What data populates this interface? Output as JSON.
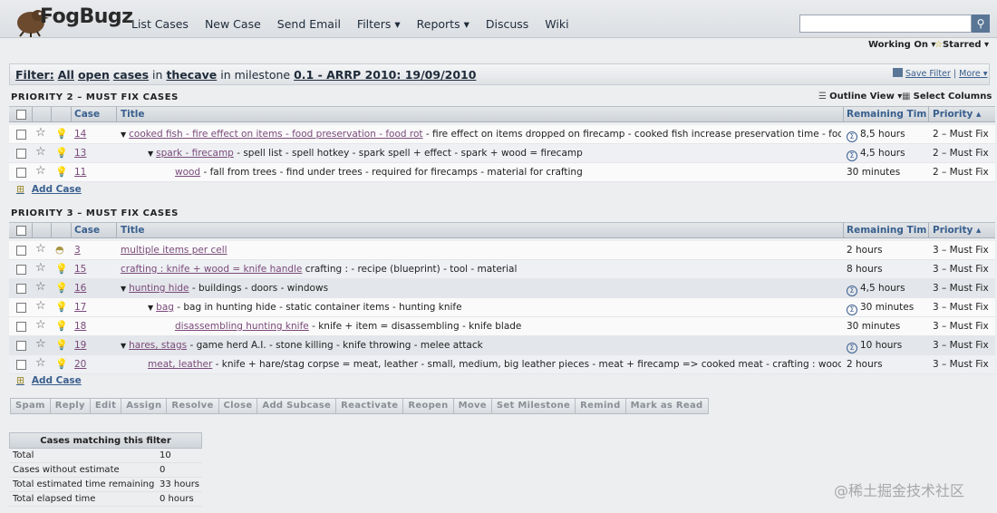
{
  "header": {
    "logo_text": "FogBugz",
    "nav": [
      "List Cases",
      "New Case",
      "Send Email",
      "Filters ▾",
      "Reports ▾",
      "Discuss",
      "Wiki"
    ],
    "search_placeholder": "",
    "working_on": "Working On ▾",
    "starred": "Starred ▾"
  },
  "filter": {
    "label": "Filter:",
    "all": "All",
    "open": "open",
    "cases": "cases",
    "in": "in",
    "project": "thecave",
    "in_milestone": "in milestone",
    "milestone": "0.1 - ARRP 2010: 19/09/2010",
    "save_filter": "Save Filter",
    "more": "More ▾"
  },
  "view": {
    "outline": "Outline View ▾",
    "select_columns": "Select Columns"
  },
  "columns": {
    "case": "Case",
    "title": "Title",
    "remaining": "Remaining Time",
    "priority": "Priority ▴"
  },
  "groups": [
    {
      "title": "PRIORITY 2 – MUST FIX CASES",
      "add_case": "Add Case",
      "rows": [
        {
          "case": "14",
          "indent": 0,
          "tri": true,
          "link": "cooked fish - fire effect on items - food preservation - food rot",
          "rest": " - fire effect on items dropped on firecamp  - cooked fish increase preservation time  - food rot",
          "rem": "8,5 hours",
          "sigma": true,
          "pri": "2 – Must Fix"
        },
        {
          "case": "13",
          "indent": 1,
          "tri": true,
          "link": "spark - firecamp",
          "rest": " - spell list - spell hotkey - spark spell + effect - spark + wood = firecamp",
          "rem": "4,5 hours",
          "sigma": true,
          "pri": "2 – Must Fix"
        },
        {
          "case": "11",
          "indent": 2,
          "tri": false,
          "link": "wood",
          "rest": " - fall from trees  - find under trees  - required for firecamps  - material for crafting",
          "rem": "30 minutes",
          "sigma": false,
          "pri": "2 – Must Fix"
        }
      ]
    },
    {
      "title": "PRIORITY 3 – MUST FIX CASES",
      "add_case": "Add Case",
      "rows": [
        {
          "case": "3",
          "indent": 0,
          "tri": false,
          "link": "multiple items per cell",
          "rest": "",
          "rem": "2 hours",
          "sigma": false,
          "pri": "3 – Must Fix"
        },
        {
          "case": "15",
          "indent": 0,
          "tri": false,
          "link": "crafting : knife + wood = knife handle",
          "rest": " crafting :  - recipe (blueprint)  - tool  - material",
          "rem": "8 hours",
          "sigma": false,
          "pri": "3 – Must Fix"
        },
        {
          "case": "16",
          "indent": 0,
          "tri": true,
          "link": "hunting hide",
          "rest": " - buildings  - doors  - windows",
          "rem": "4,5 hours",
          "sigma": true,
          "pri": "3 – Must Fix"
        },
        {
          "case": "17",
          "indent": 1,
          "tri": true,
          "link": "bag",
          "rest": " - bag in hunting hide  - static container items  - hunting knife",
          "rem": "30 minutes",
          "sigma": true,
          "pri": "3 – Must Fix"
        },
        {
          "case": "18",
          "indent": 2,
          "tri": false,
          "link": "disassembling hunting knife",
          "rest": " - knife + item = disassembling  - knife blade",
          "rem": "30 minutes",
          "sigma": false,
          "pri": "3 – Must Fix"
        },
        {
          "case": "19",
          "indent": 0,
          "tri": true,
          "link": "hares, stags",
          "rest": " - game herd A.I.  - stone killing  - knife throwing  - melee attack",
          "rem": "10 hours",
          "sigma": true,
          "pri": "3 – Must Fix"
        },
        {
          "case": "20",
          "indent": 1,
          "tri": false,
          "link": "meat, leather",
          "rest": " - knife + hare/stag corpse = meat, leather  - small, medium, big leather pieces  - meat + firecamp => cooked meat  - crafting : wood handle",
          "rem": "2 hours",
          "sigma": false,
          "pri": "3 – Must Fix"
        }
      ]
    }
  ],
  "actions": [
    "Spam",
    "Reply",
    "Edit",
    "Assign",
    "Resolve",
    "Close",
    "Add Subcase",
    "Reactivate",
    "Reopen",
    "Move",
    "Set Milestone",
    "Remind",
    "Mark as Read"
  ],
  "stats": {
    "title": "Cases matching this filter",
    "rows": [
      {
        "label": "Total",
        "value": "10"
      },
      {
        "label": "Cases without estimate",
        "value": "0"
      },
      {
        "label": "Total estimated time remaining",
        "value": "33 hours"
      },
      {
        "label": "Total elapsed time",
        "value": "0 hours"
      }
    ]
  },
  "watermark": "@稀土掘金技术社区",
  "colors": {
    "link": "#7a4a7a",
    "header_text": "#39608e",
    "accent": "#3a5f8f"
  }
}
